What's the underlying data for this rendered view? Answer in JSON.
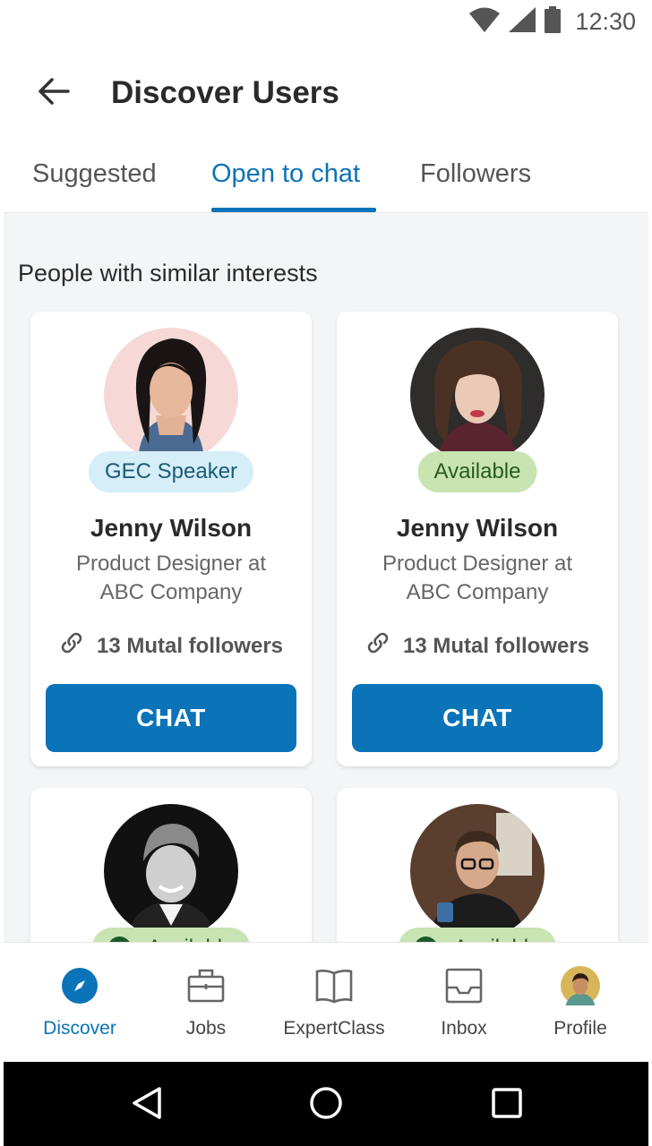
{
  "status_bar": {
    "time": "12:30"
  },
  "header": {
    "title": "Discover Users"
  },
  "tabs": [
    {
      "label": "Suggested"
    },
    {
      "label": "Open to chat"
    },
    {
      "label": "Followers"
    }
  ],
  "section": {
    "title": "People with similar interests"
  },
  "cards": [
    {
      "badge": "GEC Speaker",
      "name": "Jenny Wilson",
      "role_line1": "Product Designer at",
      "role_line2": "ABC Company",
      "mutual": "13 Mutal followers",
      "cta": "CHAT"
    },
    {
      "badge": "Available",
      "name": "Jenny Wilson",
      "role_line1": "Product Designer at",
      "role_line2": "ABC Company",
      "mutual": "13 Mutal followers",
      "cta": "CHAT"
    },
    {
      "badge": "Available"
    },
    {
      "badge": "Available"
    }
  ],
  "bottom_nav": [
    {
      "label": "Discover",
      "icon": "compass-icon"
    },
    {
      "label": "Jobs",
      "icon": "briefcase-icon"
    },
    {
      "label": "ExpertClass",
      "icon": "book-icon"
    },
    {
      "label": "Inbox",
      "icon": "inbox-icon"
    },
    {
      "label": "Profile",
      "icon": "avatar"
    }
  ],
  "colors": {
    "primary": "#0b73b7",
    "available_badge": "#c8e4b2",
    "speaker_badge": "#d5eef8"
  }
}
